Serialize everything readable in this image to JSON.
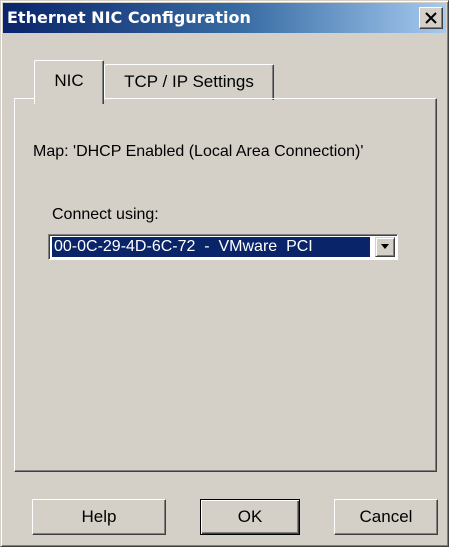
{
  "window": {
    "title": "Ethernet NIC Configuration",
    "close_icon": "close-icon"
  },
  "tabs": [
    {
      "label": "NIC",
      "selected": true
    },
    {
      "label": "TCP / IP Settings",
      "selected": false
    }
  ],
  "nic": {
    "map_text": "Map: 'DHCP Enabled (Local Area Connection)'",
    "connect_label": "Connect using:",
    "connect_value": "00-0C-29-4D-6C-72  -  VMware  PCI",
    "dropdown_icon": "chevron-down-icon"
  },
  "buttons": {
    "help": "Help",
    "ok": "OK",
    "cancel": "Cancel"
  },
  "colors": {
    "title_start": "#0a246a",
    "title_end": "#a6caf0",
    "face": "#d4d0c8",
    "selection": "#0a246a"
  }
}
